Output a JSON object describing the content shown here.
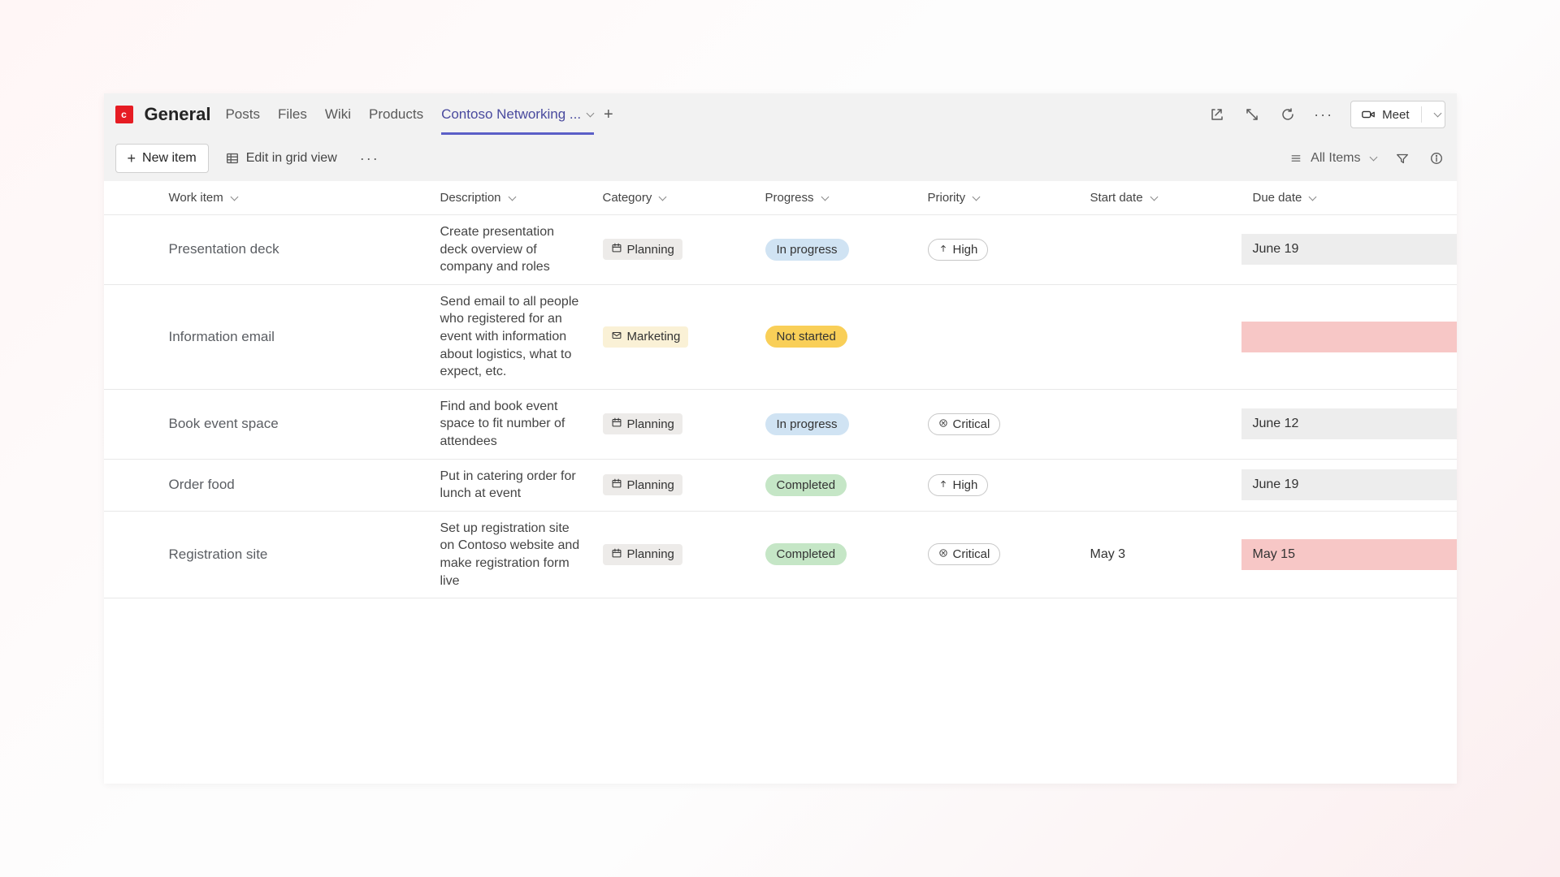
{
  "header": {
    "badge_letter": "c",
    "title": "General",
    "tabs": [
      "Posts",
      "Files",
      "Wiki",
      "Products",
      "Contoso Networking ..."
    ],
    "active_tab_index": 4
  },
  "toolbar": {
    "new_item_label": "New item",
    "edit_grid_label": "Edit in grid view",
    "all_items_label": "All Items"
  },
  "meet_label": "Meet",
  "columns": [
    "Work item",
    "Description",
    "Category",
    "Progress",
    "Priority",
    "Start date",
    "Due date"
  ],
  "rows": [
    {
      "work_item": "Presentation deck",
      "description": "Create presentation deck overview of company and roles",
      "category": {
        "label": "Planning",
        "icon": "calendar",
        "style": "default"
      },
      "progress": {
        "label": "In progress",
        "style": "inprogress"
      },
      "priority": {
        "label": "High",
        "icon": "up"
      },
      "start_date": "",
      "due_date": "June 19",
      "due_style": "normal"
    },
    {
      "work_item": "Information email",
      "description": "Send email to all people who registered for an event with information about logistics, what to expect, etc.",
      "category": {
        "label": "Marketing",
        "icon": "mail",
        "style": "marketing"
      },
      "progress": {
        "label": "Not started",
        "style": "notstarted"
      },
      "priority": null,
      "start_date": "",
      "due_date": "",
      "due_style": "overdue-empty"
    },
    {
      "work_item": "Book event space",
      "description": "Find and book event space to fit number of attendees",
      "category": {
        "label": "Planning",
        "icon": "calendar",
        "style": "default"
      },
      "progress": {
        "label": "In progress",
        "style": "inprogress"
      },
      "priority": {
        "label": "Critical",
        "icon": "x"
      },
      "start_date": "",
      "due_date": "June 12",
      "due_style": "normal"
    },
    {
      "work_item": "Order food",
      "description": "Put in catering order for lunch at event",
      "category": {
        "label": "Planning",
        "icon": "calendar",
        "style": "default"
      },
      "progress": {
        "label": "Completed",
        "style": "completed"
      },
      "priority": {
        "label": "High",
        "icon": "up"
      },
      "start_date": "",
      "due_date": "June 19",
      "due_style": "normal"
    },
    {
      "work_item": "Registration site",
      "description": "Set up registration site on Contoso website and make registration form live",
      "category": {
        "label": "Planning",
        "icon": "calendar",
        "style": "default"
      },
      "progress": {
        "label": "Completed",
        "style": "completed"
      },
      "priority": {
        "label": "Critical",
        "icon": "x"
      },
      "start_date": "May 3",
      "due_date": "May 15",
      "due_style": "overdue"
    }
  ]
}
